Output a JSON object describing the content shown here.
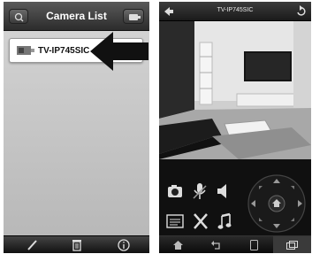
{
  "camera_list_screen": {
    "title": "Camera List",
    "cameras": [
      {
        "name": "TV-IP745SIC"
      }
    ],
    "header_left_icon": "search-icon",
    "header_right_icon": "add-camera-icon",
    "footer_icons": [
      "edit-icon",
      "delete-icon",
      "info-icon"
    ]
  },
  "live_view_screen": {
    "title": "TV-IP745SIC",
    "header_left_icon": "back-arrow-icon",
    "header_right_icon": "refresh-icon",
    "control_icons": [
      "snapshot-icon",
      "microphone-icon",
      "speaker-icon",
      "settings-icon",
      "tools-icon",
      "music-icon"
    ],
    "ptz_icons": [
      "pan-up-icon",
      "pan-down-icon",
      "pan-left-icon",
      "pan-right-icon",
      "home-icon"
    ],
    "footer_icons": [
      "home-icon",
      "back-icon",
      "phone-icon",
      "window-icon"
    ]
  },
  "colors": {
    "left_header": "#3a3a3a",
    "left_background": "#bdbdbd",
    "right_background": "#0e0e0e",
    "arrow": "#111111"
  }
}
